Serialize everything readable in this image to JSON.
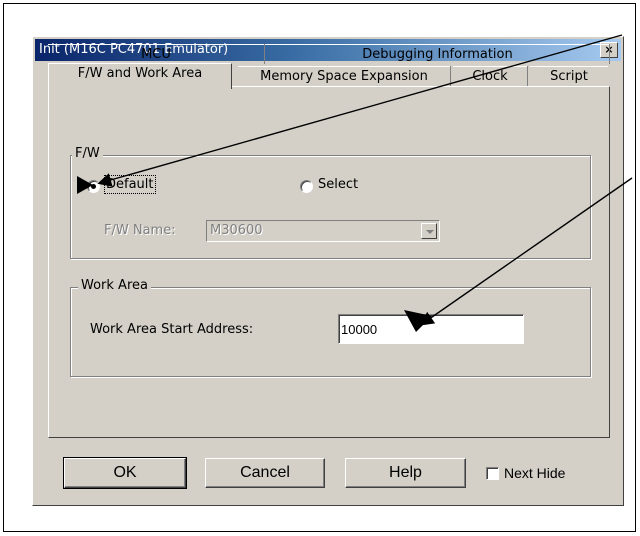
{
  "window": {
    "title": "Init (M16C PC4701 Emulator)",
    "close_glyph": "×"
  },
  "tabs": {
    "row1": [
      {
        "label": "MCU"
      },
      {
        "label": "Debugging Information"
      }
    ],
    "row2": [
      {
        "label": "F/W and Work Area",
        "active": true
      },
      {
        "label": "Memory Space Expansion"
      },
      {
        "label": "Clock"
      },
      {
        "label": "Script"
      }
    ]
  },
  "fw_group": {
    "label": "F/W",
    "radio_default_label": "Default",
    "radio_default_selected": true,
    "radio_select_label": "Select",
    "fw_name_label": "F/W Name:",
    "fw_name_value": "M30600",
    "fw_name_enabled": false
  },
  "work_area_group": {
    "label": "Work Area",
    "start_address_label": "Work Area Start Address:",
    "start_address_value": "10000"
  },
  "buttons": {
    "ok": "OK",
    "cancel": "Cancel",
    "help": "Help",
    "next_hide": "Next Hide",
    "next_hide_checked": false
  },
  "icons": {
    "close": "close-icon",
    "dropdown": "chevron-down-icon",
    "annotation_arrow": "arrow-icon"
  },
  "colors": {
    "dialog_face": "#d4d0c8",
    "titlebar_start": "#0a246a",
    "titlebar_end": "#a6caf0",
    "disabled_text": "#808080"
  }
}
